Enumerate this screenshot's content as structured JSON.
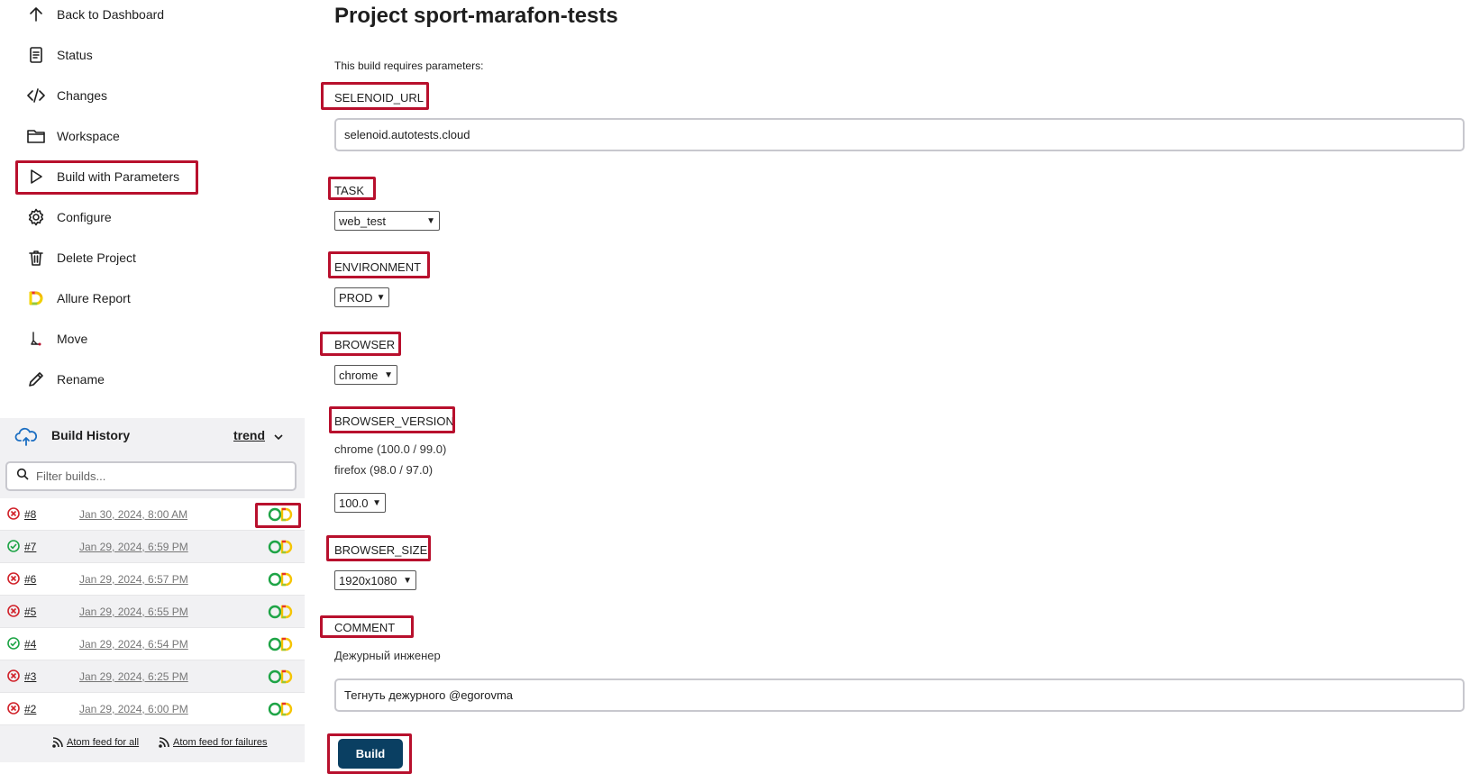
{
  "sidebar": {
    "items": [
      {
        "label": "Back to Dashboard",
        "icon": "arrow-up-icon"
      },
      {
        "label": "Status",
        "icon": "document-icon"
      },
      {
        "label": "Changes",
        "icon": "code-icon"
      },
      {
        "label": "Workspace",
        "icon": "folder-icon"
      },
      {
        "label": "Build with Parameters",
        "icon": "play-icon"
      },
      {
        "label": "Configure",
        "icon": "gear-icon"
      },
      {
        "label": "Delete Project",
        "icon": "trash-icon"
      },
      {
        "label": "Allure Report",
        "icon": "allure-icon"
      },
      {
        "label": "Move",
        "icon": "move-icon"
      },
      {
        "label": "Rename",
        "icon": "pencil-icon"
      }
    ]
  },
  "build_history": {
    "title": "Build History",
    "trend_label": "trend",
    "filter_placeholder": "Filter builds...",
    "builds": [
      {
        "number": "#8",
        "date": "Jan 30, 2024, 8:00 AM",
        "status": "failed"
      },
      {
        "number": "#7",
        "date": "Jan 29, 2024, 6:59 PM",
        "status": "success"
      },
      {
        "number": "#6",
        "date": "Jan 29, 2024, 6:57 PM",
        "status": "failed"
      },
      {
        "number": "#5",
        "date": "Jan 29, 2024, 6:55 PM",
        "status": "failed"
      },
      {
        "number": "#4",
        "date": "Jan 29, 2024, 6:54 PM",
        "status": "success"
      },
      {
        "number": "#3",
        "date": "Jan 29, 2024, 6:25 PM",
        "status": "failed"
      },
      {
        "number": "#2",
        "date": "Jan 29, 2024, 6:00 PM",
        "status": "failed"
      }
    ],
    "feed_all": "Atom feed for all",
    "feed_failures": "Atom feed for failures"
  },
  "main": {
    "title": "Project sport-marafon-tests",
    "intro": "This build requires parameters:",
    "params": {
      "selenoid_url": {
        "label": "SELENOID_URL",
        "value": "selenoid.autotests.cloud"
      },
      "task": {
        "label": "TASK",
        "value": "web_test"
      },
      "environment": {
        "label": "ENVIRONMENT",
        "value": "PROD"
      },
      "browser": {
        "label": "BROWSER",
        "value": "chrome"
      },
      "browser_version": {
        "label": "BROWSER_VERSION",
        "desc_line1": "chrome (100.0 / 99.0)",
        "desc_line2": "firefox (98.0 / 97.0)",
        "value": "100.0"
      },
      "browser_size": {
        "label": "BROWSER_SIZE",
        "value": "1920x1080"
      },
      "comment": {
        "label": "COMMENT",
        "desc": "Дежурный инженер",
        "value": "Тегнуть дежурного @egorovma"
      }
    },
    "build_button": "Build"
  },
  "colors": {
    "highlight": "#b8102d",
    "build_button": "#0a3f62",
    "failed": "#d1232b",
    "success": "#1ea446"
  }
}
